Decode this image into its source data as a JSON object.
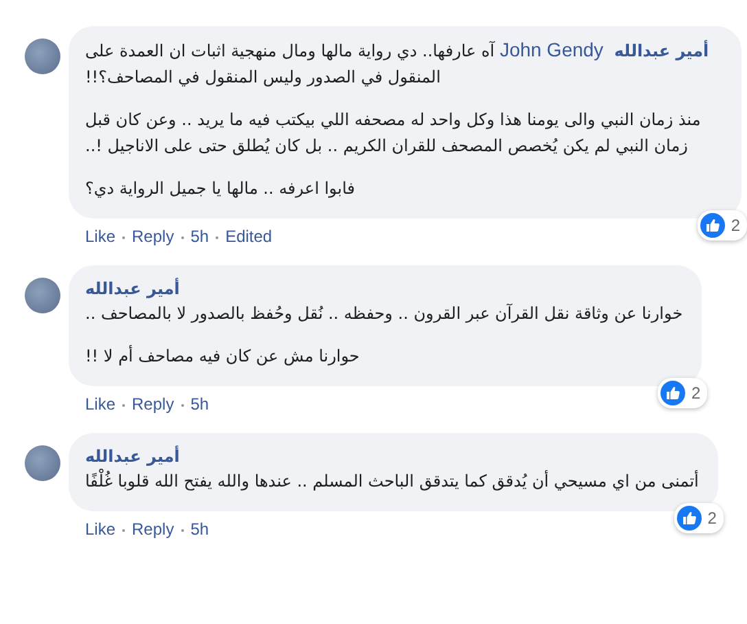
{
  "comments": [
    {
      "kind": "inline",
      "author": "أمير عبدالله",
      "mention": "John Gendy",
      "paragraphs": [
        "آه عارفها.. دي رواية مالها ومال منهجية اثبات ان العمدة على المنقول في الصدور وليس المنقول في المصاحف؟!!",
        "منذ زمان النبي والى يومنا هذا وكل واحد له مصحفه اللي بيكتب فيه ما يريد .. وعن كان قبل زمان النبي لم يكن يُخصص المصحف للقران الكريم .. بل كان يُطلق حتى على الاناجيل !..",
        "فابوا اعرفه .. مالها يا جميل الرواية دي؟"
      ],
      "reactions": "2",
      "like": "Like",
      "reply": "Reply",
      "time": "5h",
      "edited": "Edited"
    },
    {
      "kind": "stacked",
      "author": "أمير عبدالله",
      "paragraphs": [
        "خوارنا عن وثاقة نقل القرآن عبر القرون .. وحفظه .. نُقل وحُفظ بالصدور لا بالمصاحف ..",
        "حوارنا مش عن كان فيه مصاحف أم لا !!"
      ],
      "reactions": "2",
      "like": "Like",
      "reply": "Reply",
      "time": "5h"
    },
    {
      "kind": "stacked",
      "author": "أمير عبدالله",
      "paragraphs": [
        "أتمنى من اي مسيحي أن يُدقق كما يتدقق الباحث المسلم .. عندها والله يفتح الله قلوبا غُلْفًا"
      ],
      "reactions": "2",
      "like": "Like",
      "reply": "Reply",
      "time": "5h"
    }
  ]
}
